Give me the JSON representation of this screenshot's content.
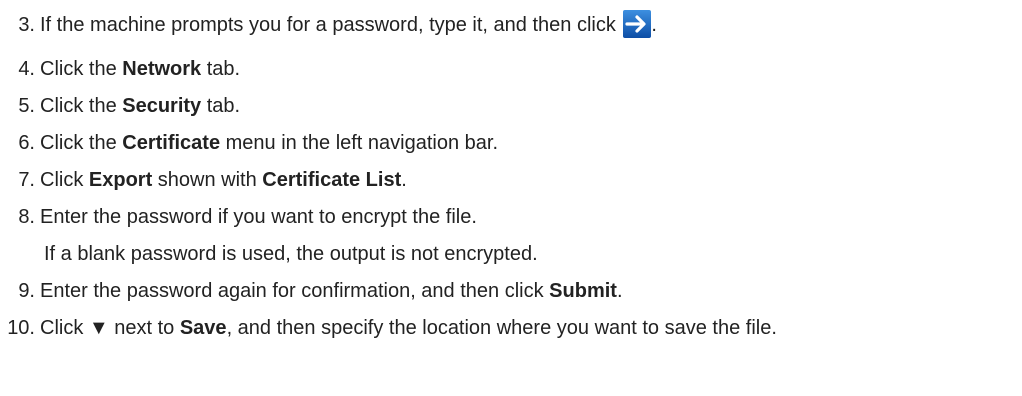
{
  "steps": [
    {
      "number": "3.",
      "before": "If the machine prompts you for a password, type it, and then click ",
      "icon": "arrow-right-icon",
      "after": "."
    },
    {
      "number": "4.",
      "before": "Click the ",
      "bold": "Network",
      "after": " tab."
    },
    {
      "number": "5.",
      "before": "Click the ",
      "bold": "Security",
      "after": " tab."
    },
    {
      "number": "6.",
      "before": "Click the ",
      "bold": "Certificate",
      "after": " menu in the left navigation bar."
    },
    {
      "number": "7.",
      "before": "Click ",
      "bold": "Export",
      "middle": " shown with ",
      "bold2": "Certificate List",
      "after": "."
    },
    {
      "number": "8.",
      "text": "Enter the password if you want to encrypt the file.",
      "note": "If a blank password is used, the output is not encrypted."
    },
    {
      "number": "9.",
      "before": "Enter the password again for confirmation, and then click ",
      "bold": "Submit",
      "after": "."
    },
    {
      "number": "10.",
      "before": "Click ",
      "symbol": "▼",
      "middle": " next to ",
      "bold": "Save",
      "after": ", and then specify the location where you want to save the file."
    }
  ],
  "colors": {
    "text": "#222222",
    "icon_bg": "#1565c0",
    "icon_arrow": "#ffffff"
  }
}
